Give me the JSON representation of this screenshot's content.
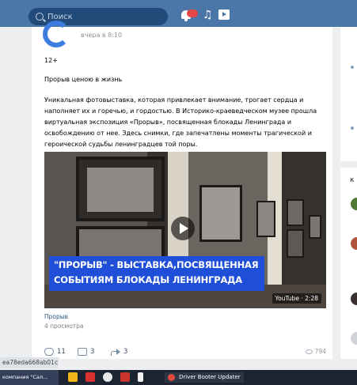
{
  "header": {
    "search_placeholder": "Поиск",
    "notifications_badge": "",
    "music_glyph": "♫"
  },
  "post": {
    "time": "вчера в 8:10",
    "age_rating": "12+",
    "title": "Прорыв ценою в жизнь",
    "body": "Уникальная фотовыставка, которая привлекает внимание, трогает сердца и наполняет их и горечью, и гордостью. В Историко-краеведческом музее прошла виртуальная экспозиция «Прорыв», посвященная блокады Ленинграда и освобождению от нее. Здесь снимки, где запечатлены моменты трагической и героической судьбы ленинградцев той поры.",
    "video": {
      "banner_line1": "\"ПРОРЫВ\" - ВЫСТАВКА,ПОСВЯЩЕННАЯ",
      "banner_line2": "СОБЫТИЯМ БЛОКАДЫ ЛЕНИНГРАДА",
      "source_duration": "YouTube · 2:28",
      "title": "Прорыв",
      "views": "4 просмотра"
    },
    "actions": {
      "likes": "11",
      "comments": "3",
      "shares": "3",
      "views": "794"
    }
  },
  "status_hash": "ea78eda668ab01c",
  "taskbar": {
    "group_label": "компания \"Сал...",
    "active_window": "Driver Booter Updater"
  }
}
